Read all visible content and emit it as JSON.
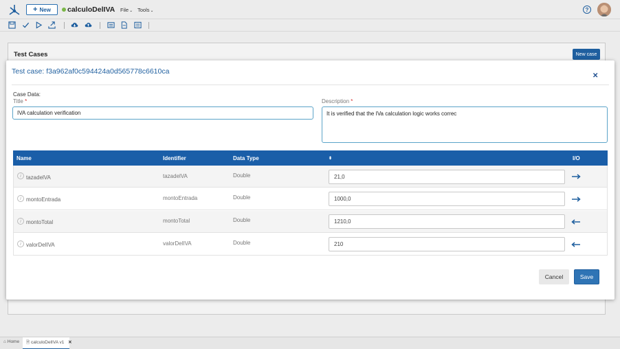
{
  "topbar": {
    "new_label": "New",
    "app_title": "calculoDelIVA",
    "menus": [
      "File",
      "Tools"
    ],
    "help_icon": "help-circle-icon"
  },
  "background": {
    "section_title": "Test Cases",
    "new_case_label": "New case"
  },
  "modal": {
    "title": "Test case: f3a962af0c594424a0d565778c6610ca",
    "case_data_label": "Case Data:",
    "title_label": "Title",
    "title_value": "IVA calculation verification",
    "description_label": "Description",
    "description_value": "It is verified that the IVa calculation logic works correc",
    "required_mark": "*"
  },
  "table": {
    "headers": {
      "name": "Name",
      "identifier": "Identifier",
      "data_type": "Data Type",
      "io": "I/O"
    },
    "rows": [
      {
        "name": "tazadelVA",
        "identifier": "tazadelVA",
        "data_type": "Double",
        "value": "21,0",
        "io": "input"
      },
      {
        "name": "montoEntrada",
        "identifier": "montoEntrada",
        "data_type": "Double",
        "value": "1000,0",
        "io": "input"
      },
      {
        "name": "montoTotal",
        "identifier": "montoTotal",
        "data_type": "Double",
        "value": "1210,0",
        "io": "output"
      },
      {
        "name": "valorDelIVA",
        "identifier": "valorDelIVA",
        "data_type": "Double",
        "value": "210",
        "io": "output"
      }
    ]
  },
  "buttons": {
    "cancel": "Cancel",
    "save": "Save"
  },
  "bottom_tabs": {
    "home": "Home",
    "active": "calculoDelIVA v1"
  },
  "colors": {
    "accent": "#1a5ea8",
    "status_dot": "#7ab648",
    "required": "#d32f2f"
  }
}
